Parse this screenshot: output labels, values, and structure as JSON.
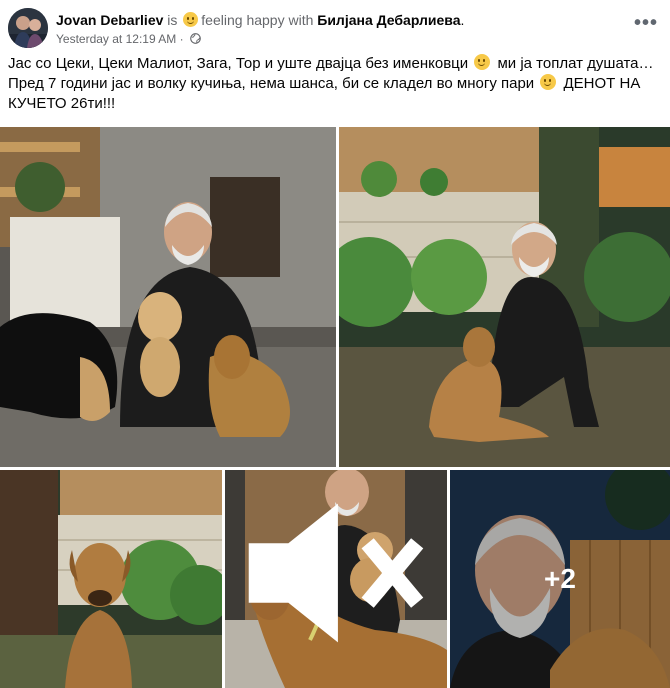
{
  "post": {
    "author": "Jovan Debarliev",
    "is_word": "is",
    "feeling": "feeling happy with",
    "tagged": "Билјана Дебарлиева",
    "end_punct": ".",
    "timestamp": "Yesterday at 12:19 AM",
    "separator": "·",
    "privacy_icon": "globe-icon",
    "more_icon": "more-options-icon",
    "more_label": "•••",
    "text_line1_a": "Јас со Цеки, Цеки Малиот, Зага, Тор и уште двајца без именковци",
    "text_line1_b": "ми ја топлат душата…",
    "text_line2_a": "Пред 7 години јас и волку кучиња, нема шанса, би се кладел во многу пари",
    "text_line2_b": "ДЕНОТ НА",
    "text_line3": "КУЧЕТО 26ти!!!"
  },
  "gallery": {
    "photos": [
      {
        "name": "photo-1",
        "description": "man crouching with dogs outdoor night"
      },
      {
        "name": "photo-2",
        "description": "man crouching with dog in garden"
      },
      {
        "name": "photo-3",
        "description": "brown dog sitting in garden"
      },
      {
        "name": "photo-4",
        "description": "man holding puppy with dog"
      },
      {
        "name": "photo-5",
        "description": "man selfie with dog"
      }
    ],
    "more_count": "+2",
    "video_muted_icon": "speaker-muted-icon"
  },
  "colors": {
    "text": "#050505",
    "muted": "#65676b",
    "emoji": "#f7c948"
  }
}
